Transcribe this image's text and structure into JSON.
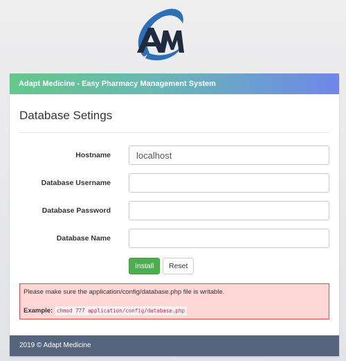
{
  "header": {
    "app_title": "Adapt Medicine - Easy Pharmacy Management System"
  },
  "logo": {
    "text": "AM",
    "colors": [
      "#2d6fb5",
      "#1f2b3f"
    ]
  },
  "form": {
    "title": "Database Setings",
    "fields": [
      {
        "label": "Hostname",
        "value": "localhost",
        "placeholder": ""
      },
      {
        "label": "Database Username",
        "value": "",
        "placeholder": ""
      },
      {
        "label": "Database Password",
        "value": "",
        "placeholder": ""
      },
      {
        "label": "Database Name",
        "value": "",
        "placeholder": ""
      }
    ],
    "install_label": "Install",
    "reset_label": "Reset"
  },
  "alert": {
    "message": "Please make sure the application/config/database.php file is writable.",
    "example_label": "Example:",
    "example_code": "chmod 777 application/config/database.php"
  },
  "footer": {
    "text": "2019 © Adapt Medicine"
  },
  "colors": {
    "header_gradient_start": "#64c889",
    "header_gradient_end": "#6f87ea",
    "install_button": "#4cae4c",
    "alert_bg": "#ffd7d7",
    "alert_border": "#e14b4b",
    "footer_bg": "#56657d"
  }
}
